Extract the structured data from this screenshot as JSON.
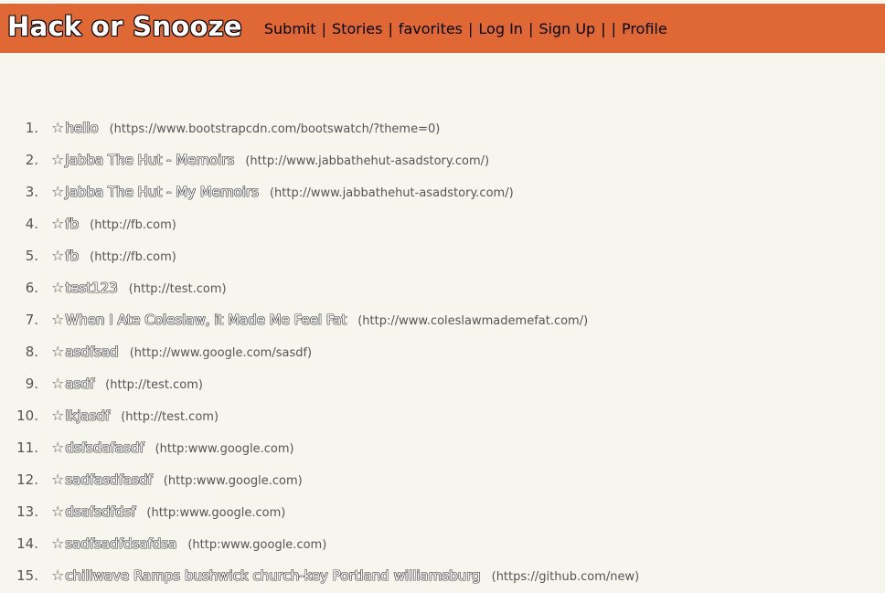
{
  "header": {
    "brand": "Hack or Snooze",
    "nav": {
      "submit": "Submit",
      "stories": "Stories",
      "favorites": "favorites",
      "login": "Log In",
      "signup": "Sign Up",
      "profile": "Profile"
    }
  },
  "stories": [
    {
      "num": "1.",
      "title": "hello",
      "host": "(https://www.bootstrapcdn.com/bootswatch/?theme=0)"
    },
    {
      "num": "2.",
      "title": "Jabba The Hut - Memoirs",
      "host": "(http://www.jabbathehut-asadstory.com/)"
    },
    {
      "num": "3.",
      "title": "Jabba The Hut - My Memoirs",
      "host": "(http://www.jabbathehut-asadstory.com/)"
    },
    {
      "num": "4.",
      "title": "fb",
      "host": "(http://fb.com)"
    },
    {
      "num": "5.",
      "title": "fb",
      "host": "(http://fb.com)"
    },
    {
      "num": "6.",
      "title": "test123",
      "host": "(http://test.com)"
    },
    {
      "num": "7.",
      "title": "When I Ate Coleslaw, it Made Me Feel Fat",
      "host": "(http://www.coleslawmademefat.com/)"
    },
    {
      "num": "8.",
      "title": "asdfsad",
      "host": "(http://www.google.com/sasdf)"
    },
    {
      "num": "9.",
      "title": "asdf",
      "host": "(http://test.com)"
    },
    {
      "num": "10.",
      "title": "lkjasdf",
      "host": "(http://test.com)"
    },
    {
      "num": "11.",
      "title": "dsfsdafasdf",
      "host": "(http:www.google.com)"
    },
    {
      "num": "12.",
      "title": "sadfasdfasdf",
      "host": "(http:www.google.com)"
    },
    {
      "num": "13.",
      "title": "dsafsdfdsf",
      "host": "(http:www.google.com)"
    },
    {
      "num": "14.",
      "title": "sadfsadfdsafdsa",
      "host": "(http:www.google.com)"
    },
    {
      "num": "15.",
      "title": "chillwave Ramps bushwick church-key Portland williamsburg",
      "host": "(https://github.com/new)"
    }
  ],
  "icons": {
    "star": "☆"
  }
}
